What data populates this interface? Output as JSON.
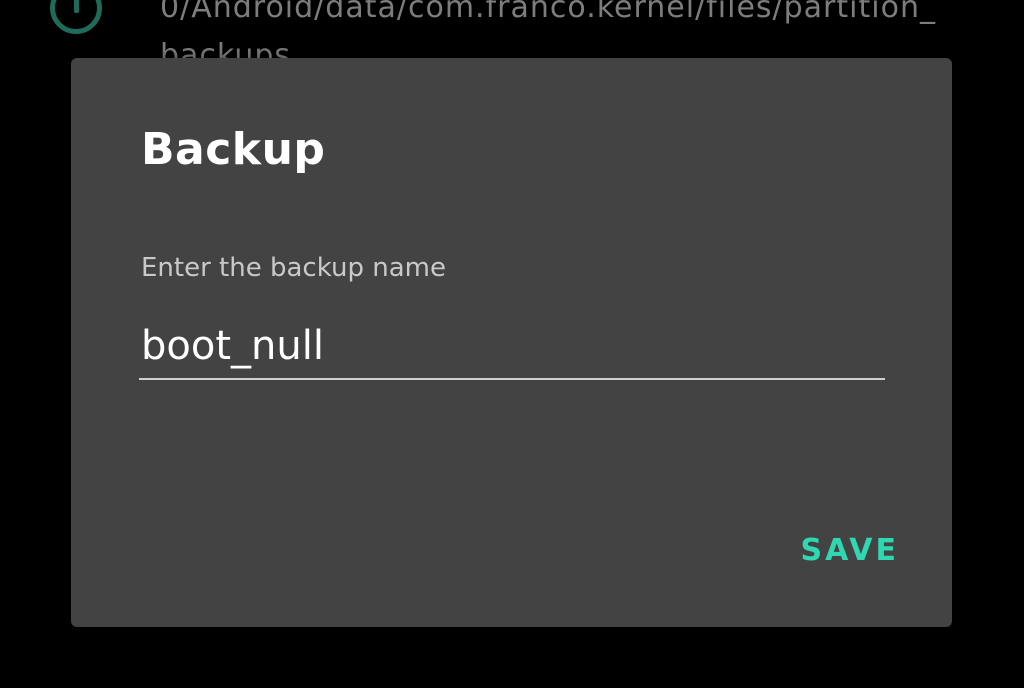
{
  "background": {
    "info_icon": "info-icon",
    "path_text": "0/Android/data/com.franco.kernel/files/partition_backups"
  },
  "dialog": {
    "title": "Backup",
    "field_label": "Enter the backup name",
    "field_value": "boot_null",
    "save_label": "SAVE"
  },
  "colors": {
    "background": "#000000",
    "dialog_bg": "#434343",
    "accent": "#2fd8b0",
    "info_icon": "#2a8f78"
  }
}
